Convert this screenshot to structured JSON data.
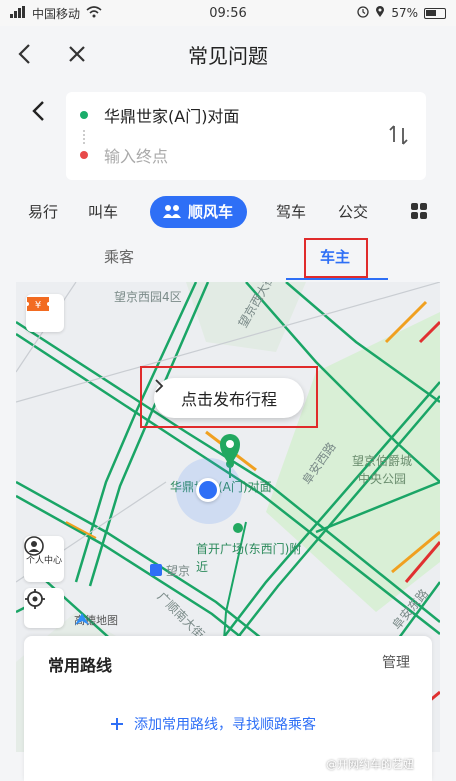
{
  "status_bar": {
    "carrier": "中国移动",
    "time": "09:56",
    "battery": "57%"
  },
  "header": {
    "title": "常见问题"
  },
  "route": {
    "start": "华鼎世家(A门)对面",
    "end_placeholder": "输入终点"
  },
  "mode_tabs": [
    {
      "label": "易行"
    },
    {
      "label": "叫车"
    },
    {
      "label": "顺风车"
    },
    {
      "label": "驾车"
    },
    {
      "label": "公交"
    }
  ],
  "sub_tabs": {
    "passenger": "乘客",
    "driver": "车主"
  },
  "map": {
    "labels": {
      "district": "望京西园4区",
      "road_taiyang": "望京西大街",
      "road_huguang": "阜安西路",
      "park": "望京伯爵城\n中央公园",
      "poi_home": "华鼎世家(A门)对面",
      "poi_plaza": "首开广场(东西门)附近",
      "road_bottom": "阜安东路",
      "road_guangshun": "广顺南大街",
      "metro": "望京"
    },
    "publish_label": "点击发布行程",
    "personal_center": "个人中心",
    "logo": "高德地图"
  },
  "routes_sheet": {
    "title": "常用路线",
    "manage": "管理",
    "add_label": "添加常用路线，寻找顺路乘客"
  },
  "watermark": "@开网约车的艺妞",
  "colors": {
    "accent": "#2e6ff6",
    "highlight": "#e02b2b",
    "road_green": "#1aa566",
    "pin_green": "#22a860"
  }
}
